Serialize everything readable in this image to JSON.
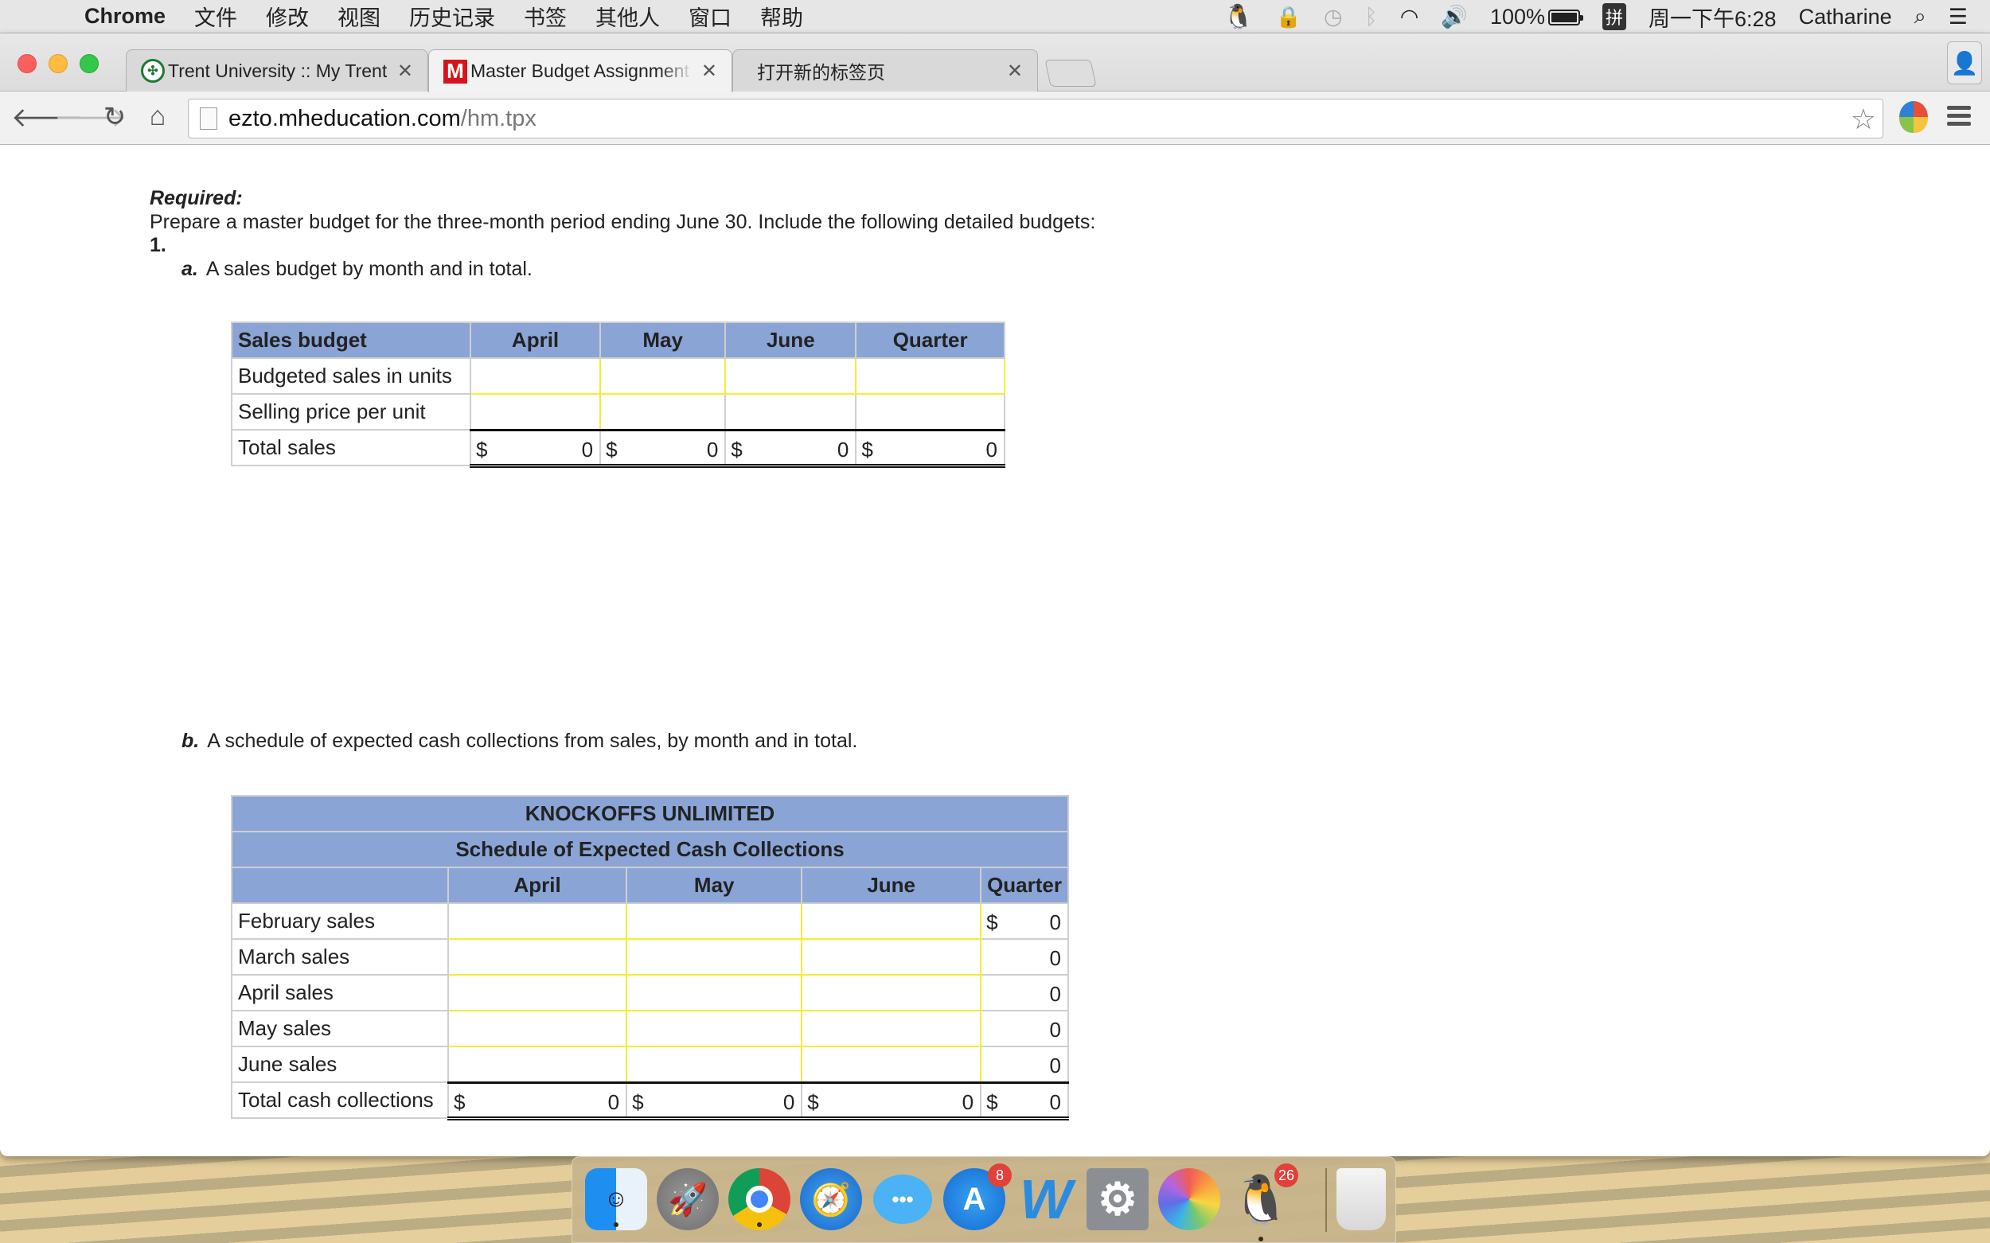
{
  "menubar": {
    "app_name": "Chrome",
    "items": [
      "文件",
      "修改",
      "视图",
      "历史记录",
      "书签",
      "其他人",
      "窗口",
      "帮助"
    ],
    "battery_percent": "100%",
    "ime": "拼",
    "clock": "周一下午6:28",
    "user": "Catharine"
  },
  "browser": {
    "tabs": [
      {
        "title": "Trent University :: My Trent",
        "favicon": "trent-logo",
        "active": false
      },
      {
        "title": "Master Budget Assignment",
        "favicon": "mcgraw-hill-m",
        "active": true
      },
      {
        "title": "打开新的标签页",
        "favicon": "",
        "active": false
      }
    ],
    "url_host": "ezto.mheducation.com",
    "url_path": "/hm.tpx"
  },
  "page": {
    "required_label": "Required:",
    "instructions": "Prepare a master budget for the three-month period ending June 30. Include the following detailed budgets:",
    "part_number": "1.",
    "part_a_label": "a.",
    "part_a_text": "A sales budget by month and in total.",
    "part_b_label": "b.",
    "part_b_text": "A schedule of expected cash collections from sales, by month and in total."
  },
  "sales_budget": {
    "header": "Sales budget",
    "columns": [
      "April",
      "May",
      "June",
      "Quarter"
    ],
    "rows": {
      "units_label": "Budgeted sales in units",
      "units_values": [
        "",
        "",
        "",
        ""
      ],
      "price_label": "Selling price per unit",
      "price_value": "",
      "total_label": "Total sales",
      "currency": "$",
      "total_values": [
        "0",
        "0",
        "0",
        "0"
      ]
    }
  },
  "cash_collections": {
    "company": "KNOCKOFFS UNLIMITED",
    "title": "Schedule of Expected Cash Collections",
    "columns": [
      "April",
      "May",
      "June",
      "Quarter"
    ],
    "currency": "$",
    "rows": [
      {
        "label": "February sales",
        "values": [
          "",
          "",
          ""
        ],
        "quarter": "0"
      },
      {
        "label": "March sales",
        "values": [
          "",
          "",
          ""
        ],
        "quarter": "0"
      },
      {
        "label": "April sales",
        "values": [
          "",
          "",
          ""
        ],
        "quarter": "0"
      },
      {
        "label": "May sales",
        "values": [
          "",
          "",
          ""
        ],
        "quarter": "0"
      },
      {
        "label": "June sales",
        "values": [
          "",
          "",
          ""
        ],
        "quarter": "0"
      }
    ],
    "total_label": "Total cash collections",
    "total_values": [
      "0",
      "0",
      "0",
      "0"
    ]
  },
  "dock": {
    "apps": [
      {
        "name": "Finder",
        "running": true,
        "badge": ""
      },
      {
        "name": "Launchpad",
        "running": false,
        "badge": ""
      },
      {
        "name": "Chrome",
        "running": true,
        "badge": ""
      },
      {
        "name": "Safari",
        "running": false,
        "badge": ""
      },
      {
        "name": "Messages",
        "running": false,
        "badge": ""
      },
      {
        "name": "App Store",
        "running": false,
        "badge": "8"
      },
      {
        "name": "Word",
        "running": false,
        "badge": ""
      },
      {
        "name": "System Preferences",
        "running": false,
        "badge": ""
      },
      {
        "name": "Photos",
        "running": false,
        "badge": ""
      },
      {
        "name": "QQ",
        "running": true,
        "badge": "26"
      },
      {
        "name": "Trash",
        "running": false,
        "badge": ""
      }
    ]
  }
}
